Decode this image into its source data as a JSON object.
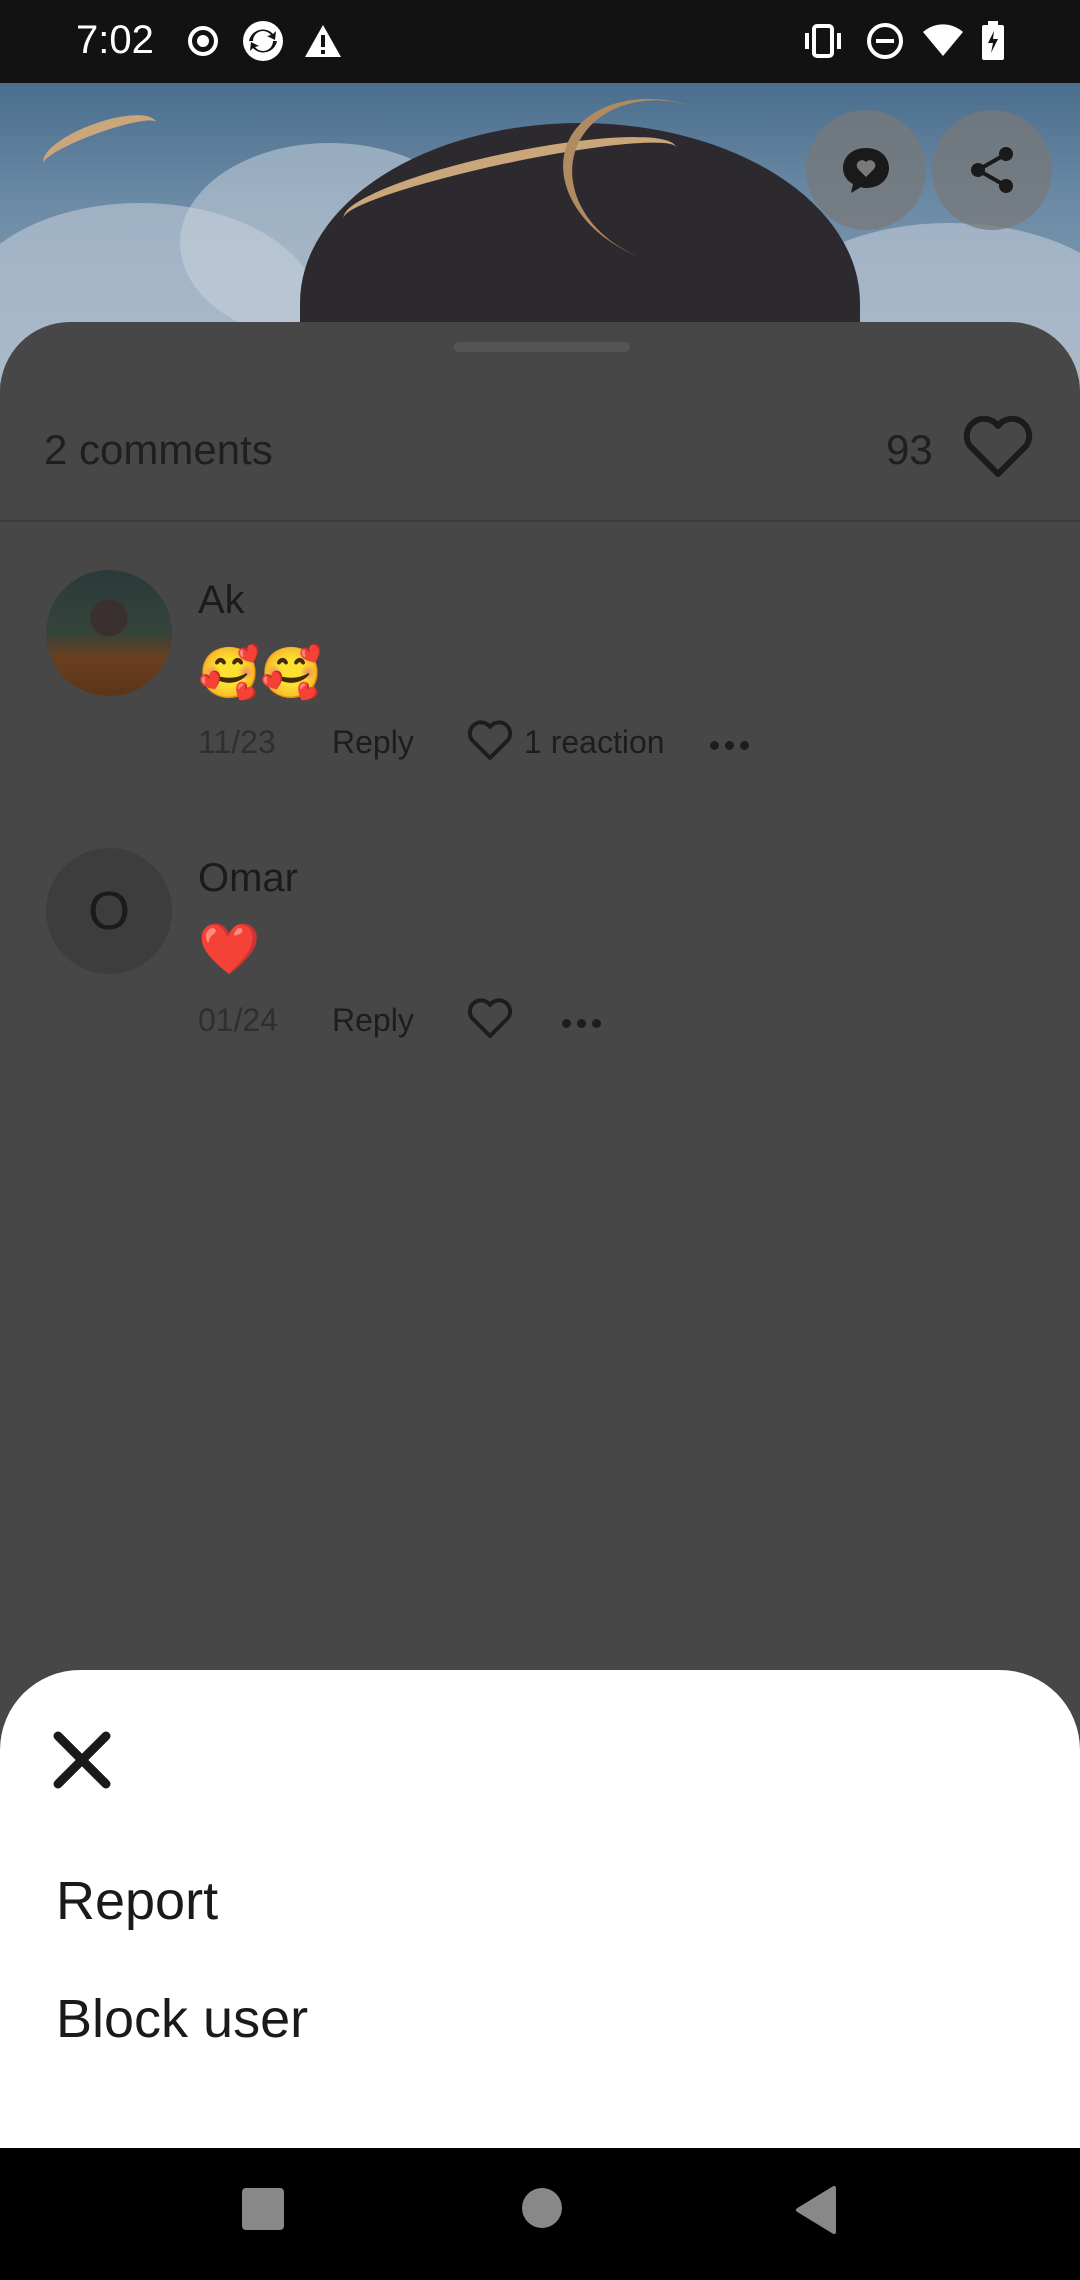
{
  "status_bar": {
    "time": "7:02",
    "left_icons": [
      "record-icon",
      "sync-app-icon",
      "warning-icon"
    ],
    "right_icons": [
      "vibrate-icon",
      "do-not-disturb-icon",
      "wifi-icon",
      "battery-charging-icon"
    ]
  },
  "hero": {
    "actions": [
      "comment-bubble-icon",
      "share-icon"
    ]
  },
  "comments_panel": {
    "count_label": "2 comments",
    "likes_count": "93",
    "comments": [
      {
        "author": "Ak",
        "avatar": "photo",
        "body": "🥰🥰",
        "date": "11/23",
        "reply_label": "Reply",
        "reaction_label": "1 reaction"
      },
      {
        "author": "Omar",
        "avatar_letter": "O",
        "body": "❤️",
        "date": "01/24",
        "reply_label": "Reply",
        "reaction_label": ""
      }
    ]
  },
  "bottom_sheet": {
    "items": [
      "Report",
      "Block user"
    ]
  },
  "colors": {
    "overlay_panel": "#474747",
    "sheet_bg": "#ffffff",
    "status_bar_bg": "#121212"
  }
}
